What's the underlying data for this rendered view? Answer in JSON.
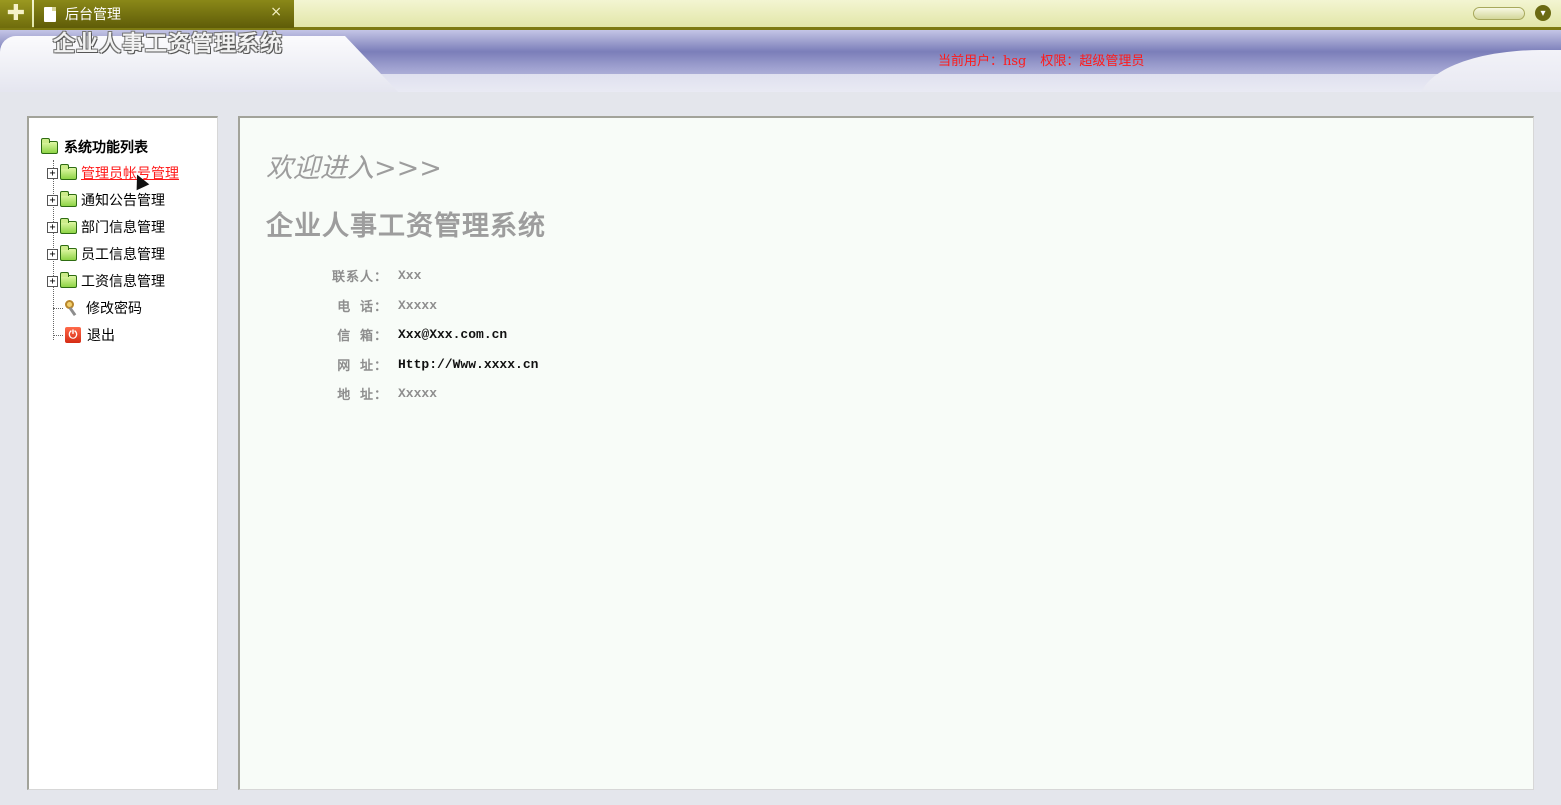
{
  "tabbar": {
    "tab_label": "后台管理",
    "close_glyph": "×",
    "add_glyph": "✚",
    "dropdown_glyph": "▾",
    "icons": [
      "plus-icon",
      "document-icon",
      "close-icon",
      "chevron-down-icon"
    ]
  },
  "header": {
    "app_title": "企业人事工资管理系统",
    "current_user_label": "当前用户：",
    "current_user": "hsg",
    "permission_label": "权限：",
    "permission": "超级管理员"
  },
  "sidebar": {
    "root_label": "系统功能列表",
    "expand_glyph": "+",
    "items": [
      {
        "label": "管理员帐号管理",
        "icon": "folder-icon",
        "expandable": true,
        "active": true
      },
      {
        "label": "通知公告管理",
        "icon": "folder-icon",
        "expandable": true,
        "active": false
      },
      {
        "label": "部门信息管理",
        "icon": "folder-icon",
        "expandable": true,
        "active": false
      },
      {
        "label": "员工信息管理",
        "icon": "folder-icon",
        "expandable": true,
        "active": false
      },
      {
        "label": "工资信息管理",
        "icon": "folder-icon",
        "expandable": true,
        "active": false
      },
      {
        "label": "修改密码",
        "icon": "key-icon",
        "expandable": false,
        "active": false
      },
      {
        "label": "退出",
        "icon": "power-icon",
        "expandable": false,
        "active": false
      }
    ],
    "power_glyph": "⏻"
  },
  "main": {
    "welcome": "欢迎进入>>>",
    "system_name": "企业人事工资管理系统",
    "info": [
      {
        "label": "联系人：",
        "value": "Xxx"
      },
      {
        "label": "电 话：",
        "value": "Xxxxx"
      },
      {
        "label": "信 箱：",
        "value": "Xxx@Xxx.com.cn"
      },
      {
        "label": "网 址：",
        "value": "Http://Www.xxxx.cn"
      },
      {
        "label": "地 址：",
        "value": "Xxxxx"
      }
    ]
  },
  "colors": {
    "tab_active": "#6f6c0c",
    "tabbar_bg": "#e2e6a8",
    "banner": "#7b7eb9",
    "user_info": "#ff1a1a",
    "active_link": "#ff1a1a",
    "muted_text": "#9d9d9d",
    "folder": "#8ed446"
  }
}
